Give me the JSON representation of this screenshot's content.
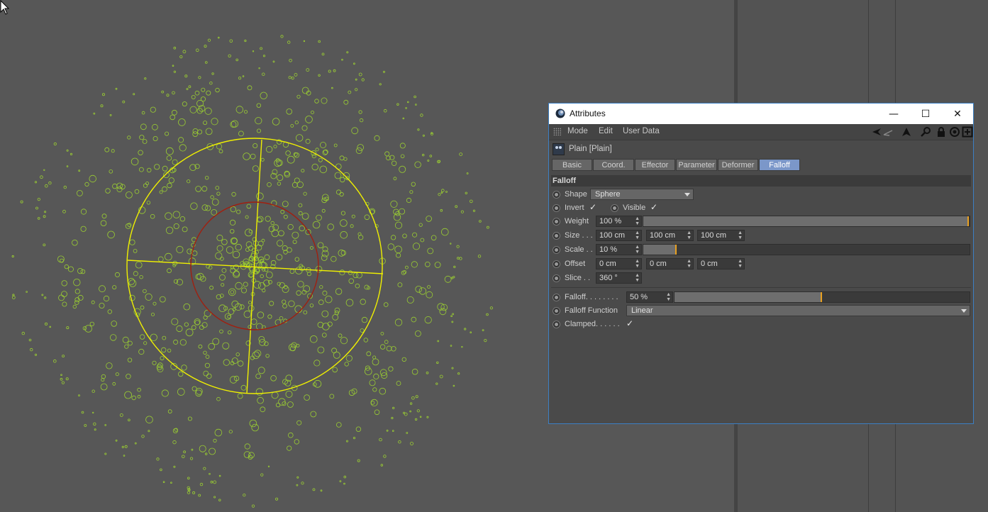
{
  "window": {
    "title": "Attributes",
    "minimize_glyph": "—",
    "maximize_glyph": "☐",
    "close_glyph": "✕"
  },
  "menu": {
    "mode": "Mode",
    "edit": "Edit",
    "user_data": "User Data"
  },
  "object": {
    "name": "Plain [Plain]"
  },
  "tabs": [
    {
      "label": "Basic",
      "active": false
    },
    {
      "label": "Coord.",
      "active": false
    },
    {
      "label": "Effector",
      "active": false
    },
    {
      "label": "Parameter",
      "active": false
    },
    {
      "label": "Deformer",
      "active": false
    },
    {
      "label": "Falloff",
      "active": true
    }
  ],
  "section": {
    "title": "Falloff"
  },
  "fields": {
    "shape": {
      "label": "Shape",
      "value": "Sphere"
    },
    "invert": {
      "label": "Invert",
      "checked": true
    },
    "visible": {
      "label": "Visible",
      "checked": true
    },
    "weight": {
      "label": "Weight",
      "value": "100 %",
      "level": 1.0
    },
    "size": {
      "label": "Size . . .",
      "x": "100 cm",
      "y": "100 cm",
      "z": "100 cm"
    },
    "scale": {
      "label": "Scale . .",
      "value": "10 %",
      "level": 0.1
    },
    "offset": {
      "label": "Offset",
      "x": "0 cm",
      "y": "0 cm",
      "z": "0 cm"
    },
    "slice": {
      "label": "Slice . .",
      "value": "360 °"
    },
    "falloff": {
      "label": "Falloff. . . . . . . .",
      "value": "50 %",
      "level": 0.5
    },
    "falloff_function": {
      "label": "Falloff Function",
      "value": "Linear"
    },
    "clamped": {
      "label": "Clamped. . . . . .",
      "checked": true
    }
  },
  "check_glyph": "✓",
  "colors": {
    "viewport_bg": "#575757",
    "particles": "#9acd32",
    "falloff_outer": "#f0f000",
    "falloff_inner": "#a02010",
    "active_tab": "#7b97c9",
    "slider_marker": "#e8a020",
    "window_border": "#3c7fc4"
  }
}
